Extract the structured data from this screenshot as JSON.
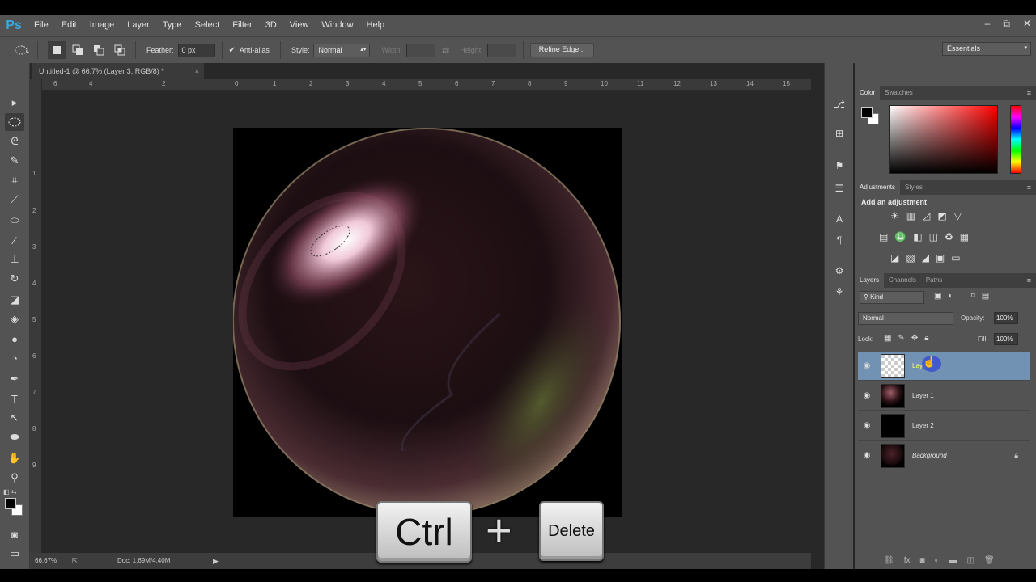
{
  "app": {
    "logo": "Ps",
    "menu": [
      "File",
      "Edit",
      "Image",
      "Layer",
      "Type",
      "Select",
      "Filter",
      "3D",
      "View",
      "Window",
      "Help"
    ],
    "window_controls": [
      "–",
      "⧉",
      "✕"
    ]
  },
  "options": {
    "feather_label": "Feather:",
    "feather_value": "0 px",
    "antialias_label": "Anti-alias",
    "style_label": "Style:",
    "style_value": "Normal",
    "width_label": "Width:",
    "height_label": "Height:",
    "refine_edge": "Refine Edge...",
    "workspace": "Essentials"
  },
  "document": {
    "tab_title": "Untitled-1 @ 66.7% (Layer 3, RGB/8) *",
    "close": "×",
    "ruler_h": [
      "6",
      "4",
      "2",
      "0",
      "1",
      "2",
      "3",
      "4",
      "5",
      "6",
      "7",
      "8",
      "9",
      "10",
      "11",
      "12",
      "13",
      "14",
      "15"
    ],
    "ruler_v": [
      "1",
      "2",
      "3",
      "4",
      "5",
      "6",
      "7",
      "8",
      "9"
    ],
    "zoom": "66.67%",
    "doc_size": "Doc: 1.69M/4.40M"
  },
  "color_panel": {
    "tabs": [
      "Color",
      "Swatches"
    ],
    "colors": {
      "hue": "#ff0000",
      "fg": "#000000",
      "bg": "#ffffff"
    }
  },
  "adjustments_panel": {
    "tabs": [
      "Adjustments",
      "Styles"
    ],
    "heading": "Add an adjustment"
  },
  "layers_panel": {
    "tabs": [
      "Layers",
      "Channels",
      "Paths"
    ],
    "filter_kind": "Kind",
    "blend_mode": "Normal",
    "opacity_label": "Opacity:",
    "opacity_value": "100%",
    "lock_label": "Lock:",
    "fill_label": "Fill:",
    "fill_value": "100%",
    "layers": [
      {
        "name": "Layer 3",
        "selected": true,
        "italic": false
      },
      {
        "name": "Layer 1",
        "selected": false,
        "italic": false
      },
      {
        "name": "Layer 2",
        "selected": false,
        "italic": false
      },
      {
        "name": "Background",
        "selected": false,
        "italic": true
      }
    ]
  },
  "overlay": {
    "key1": "Ctrl",
    "plus": "+",
    "key2": "Delete"
  }
}
